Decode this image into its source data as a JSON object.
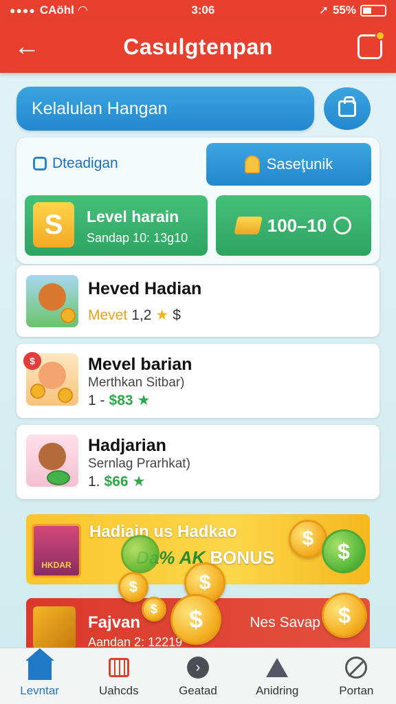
{
  "status": {
    "carrier": "CAöhl",
    "time": "3:06",
    "battery": "55%"
  },
  "appbar": {
    "title": "Casulgtenpan"
  },
  "search": {
    "text": "Kelalulan Hangan"
  },
  "panel": {
    "label": "Dteadigan",
    "claim_label": "Saseţunik",
    "level_title": "Level harain",
    "level_sub": "Sandap 10: 13g10",
    "level_icon": "S",
    "coins": "100–10"
  },
  "items": [
    {
      "title": "Heved Hadian",
      "sub": "",
      "meta_a": "Mevet",
      "meta_b": "1,2",
      "meta_c": "$"
    },
    {
      "title": "Mevel barian",
      "sub": "Merthkan Sitbar)",
      "meta_a": "1 -",
      "meta_b": "$83",
      "meta_c": ""
    },
    {
      "title": "Hadjarian",
      "sub": "Sernlag Prarhkat)",
      "meta_a": "1.",
      "meta_b": "$66",
      "meta_c": ""
    }
  ],
  "item_badge": "$",
  "banner": {
    "title": "Hadiain us Hadkao",
    "bonus_a": "Da% AK",
    "bonus_b": "BONUS",
    "img_label": "HKDAR"
  },
  "bottom_card": {
    "title": "Fajvan",
    "sub": "Aandan 2: 12219",
    "right": "Nes Savap"
  },
  "coin_symbol": "$",
  "tabs": [
    {
      "label": "Levntar",
      "icon": "home-icon"
    },
    {
      "label": "Uahcds",
      "icon": "calendar-icon"
    },
    {
      "label": "Geatad",
      "icon": "chevron-circle-icon"
    },
    {
      "label": "Anidring",
      "icon": "mountain-icon"
    },
    {
      "label": "Portan",
      "icon": "compass-icon"
    }
  ],
  "colors": {
    "primary": "#e8402f",
    "blue": "#2289cf",
    "green": "#2ea461",
    "gold": "#f4ae22"
  }
}
